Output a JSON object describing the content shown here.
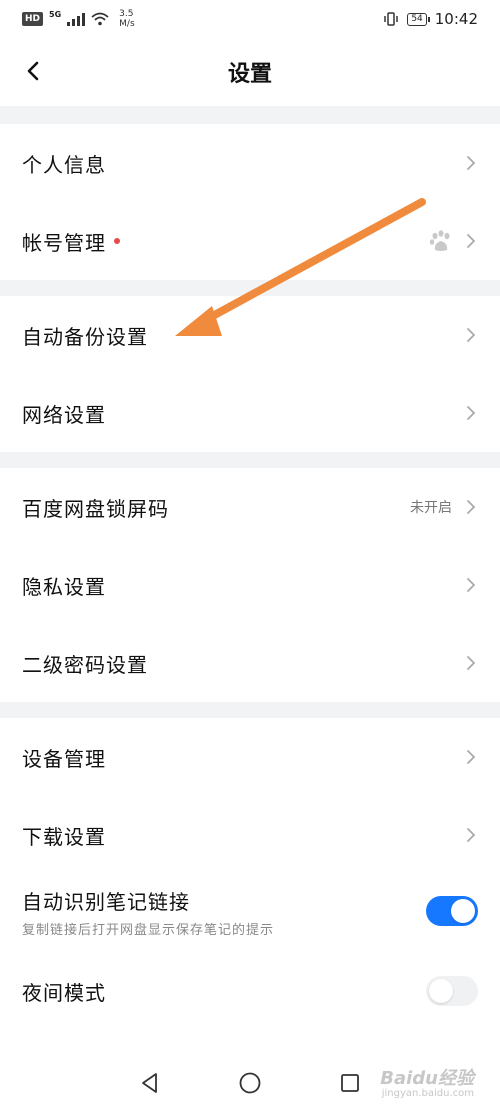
{
  "status_bar": {
    "hd": "HD",
    "network": "5G",
    "speed_value": "3.5",
    "speed_unit": "M/s",
    "battery": "54",
    "time": "10:42"
  },
  "header": {
    "title": "设置",
    "back_icon": "chevron-left-icon"
  },
  "sections": {
    "account": {
      "personal_info": "个人信息",
      "account_manage": "帐号管理",
      "account_badge_icon": "baidu-paw-icon"
    },
    "backup": {
      "auto_backup": "自动备份设置",
      "network": "网络设置"
    },
    "security": {
      "lock_code": "百度网盘锁屏码",
      "lock_code_status": "未开启",
      "privacy": "隐私设置",
      "second_password": "二级密码设置"
    },
    "general": {
      "device_manage": "设备管理",
      "download": "下载设置",
      "auto_note_link": "自动识别笔记链接",
      "auto_note_link_desc": "复制链接后打开网盘显示保存笔记的提示",
      "auto_note_link_on": true,
      "night_mode": "夜间模式",
      "night_mode_on": false
    }
  },
  "colors": {
    "accent": "#1677ff",
    "arrow": "#f08a3c",
    "dot": "#e5484d",
    "divider": "#f2f3f5"
  },
  "nav": {
    "back_icon": "triangle-back-icon",
    "home_icon": "circle-home-icon",
    "recent_icon": "square-recent-icon"
  },
  "watermark": {
    "text": "Baidu经验",
    "sub": "jingyan.baidu.com"
  }
}
